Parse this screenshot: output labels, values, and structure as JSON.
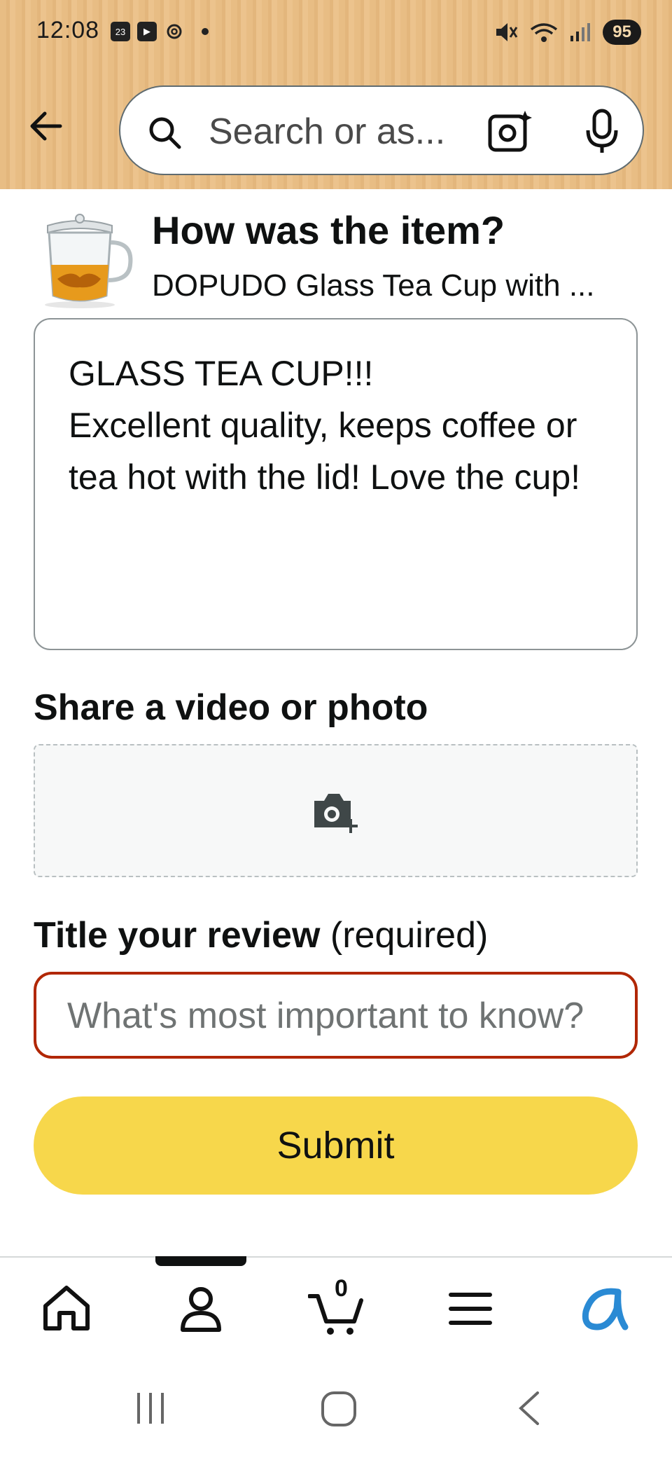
{
  "status_bar": {
    "time": "12:08",
    "calendar_day": "23",
    "battery": "95"
  },
  "search": {
    "placeholder": "Search or as..."
  },
  "review": {
    "prompt_title": "How was the item?",
    "product_name": "DOPUDO Glass Tea Cup with ...",
    "text": "GLASS TEA CUP!!!\nExcellent quality, keeps coffee or tea hot with the lid! Love the cup!",
    "media_label": "Share a video or photo",
    "title_label_bold": "Title your review",
    "title_label_suffix": " (required)",
    "title_placeholder": "What's most important to know?",
    "submit_label": "Submit"
  },
  "bottom_nav": {
    "cart_count": "0",
    "active_tab": "account"
  },
  "colors": {
    "header_bg": "#e8bd84",
    "submit_bg": "#f7d74b",
    "error_border": "#b12704",
    "alexa_blue": "#2a8ad4"
  }
}
